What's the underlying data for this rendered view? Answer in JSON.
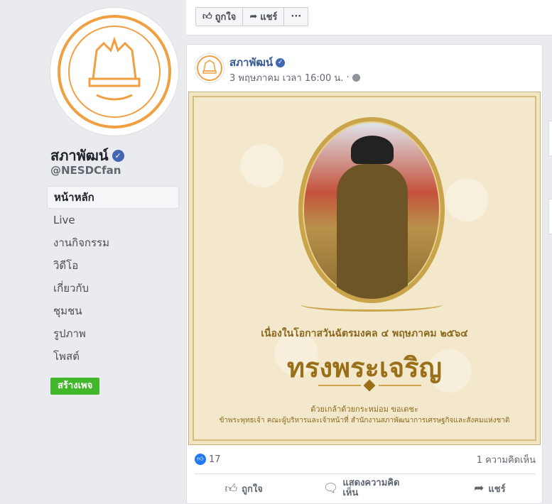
{
  "sidebar": {
    "page_name": "สภาพัฒน์",
    "handle": "@NESDCfan",
    "items": [
      {
        "label": "หน้าหลัก",
        "active": true
      },
      {
        "label": "Live"
      },
      {
        "label": "งานกิจกรรม"
      },
      {
        "label": "วิดีโอ"
      },
      {
        "label": "เกี่ยวกับ"
      },
      {
        "label": "ชุมชน"
      },
      {
        "label": "รูปภาพ"
      },
      {
        "label": "โพสต์"
      }
    ],
    "create_page": "สร้างเพจ"
  },
  "topbar": {
    "like": "ถูกใจ",
    "share": "แชร์",
    "more": "···"
  },
  "post": {
    "author": "สภาพัฒน์",
    "time": "3 พฤษภาคม เวลา 16:00 น.",
    "separator": "·",
    "image": {
      "line1": "เนื่องในโอกาสวันฉัตรมงคล ๔ พฤษภาคม ๒๕๖๔",
      "title": "ทรงพระเจริญ",
      "line2": "ด้วยเกล้าด้วยกระหม่อม ขอเดชะ",
      "line3": "ข้าพระพุทธเจ้า คณะผู้บริหารและเจ้าหน้าที่ สำนักงานสภาพัฒนาการเศรษฐกิจและสังคมแห่งชาติ"
    },
    "like_count": "17",
    "comment_count": "1 ความคิดเห็น",
    "actions": {
      "like": "ถูกใจ",
      "comment": "แสดงความคิดเห็น",
      "share": "แชร์"
    }
  },
  "colors": {
    "accent": "#385898",
    "create_button": "#42b72a",
    "logo_orange": "#f0a040",
    "gold": "#9a6f1a"
  },
  "icons": [
    "thumbs-up-icon",
    "share-arrow-icon",
    "more-icon",
    "verified-icon",
    "globe-icon",
    "comment-icon",
    "like-reaction-icon"
  ]
}
